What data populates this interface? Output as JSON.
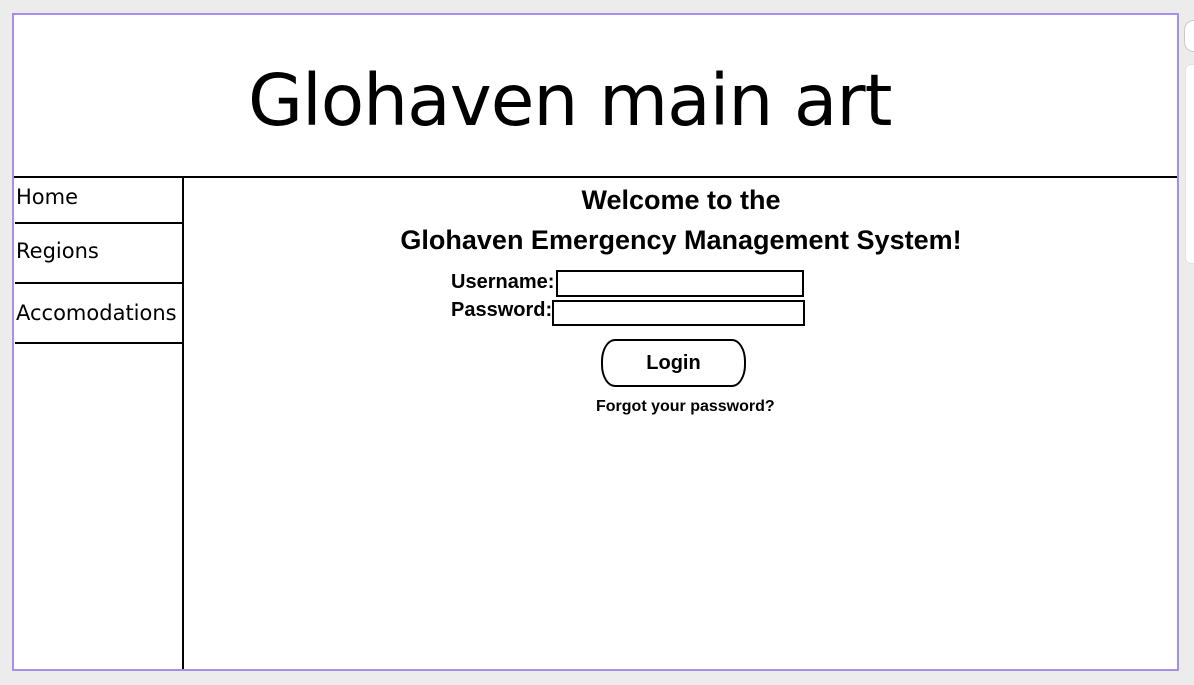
{
  "banner": {
    "title": "Glohaven main art"
  },
  "sidebar": {
    "items": [
      {
        "label": "Home"
      },
      {
        "label": "Regions"
      },
      {
        "label": "Accomodations"
      }
    ]
  },
  "main": {
    "welcome_line1": "Welcome to the",
    "welcome_line2": "Glohaven Emergency Management System!",
    "username_label": "Username:",
    "username_value": "",
    "password_label": "Password:",
    "password_value": "",
    "login_label": "Login",
    "forgot_link": "Forgot your password?"
  },
  "colors": {
    "frame_border": "#a98ee8",
    "background": "#ececec",
    "canvas": "#ffffff",
    "ink": "#000000"
  }
}
